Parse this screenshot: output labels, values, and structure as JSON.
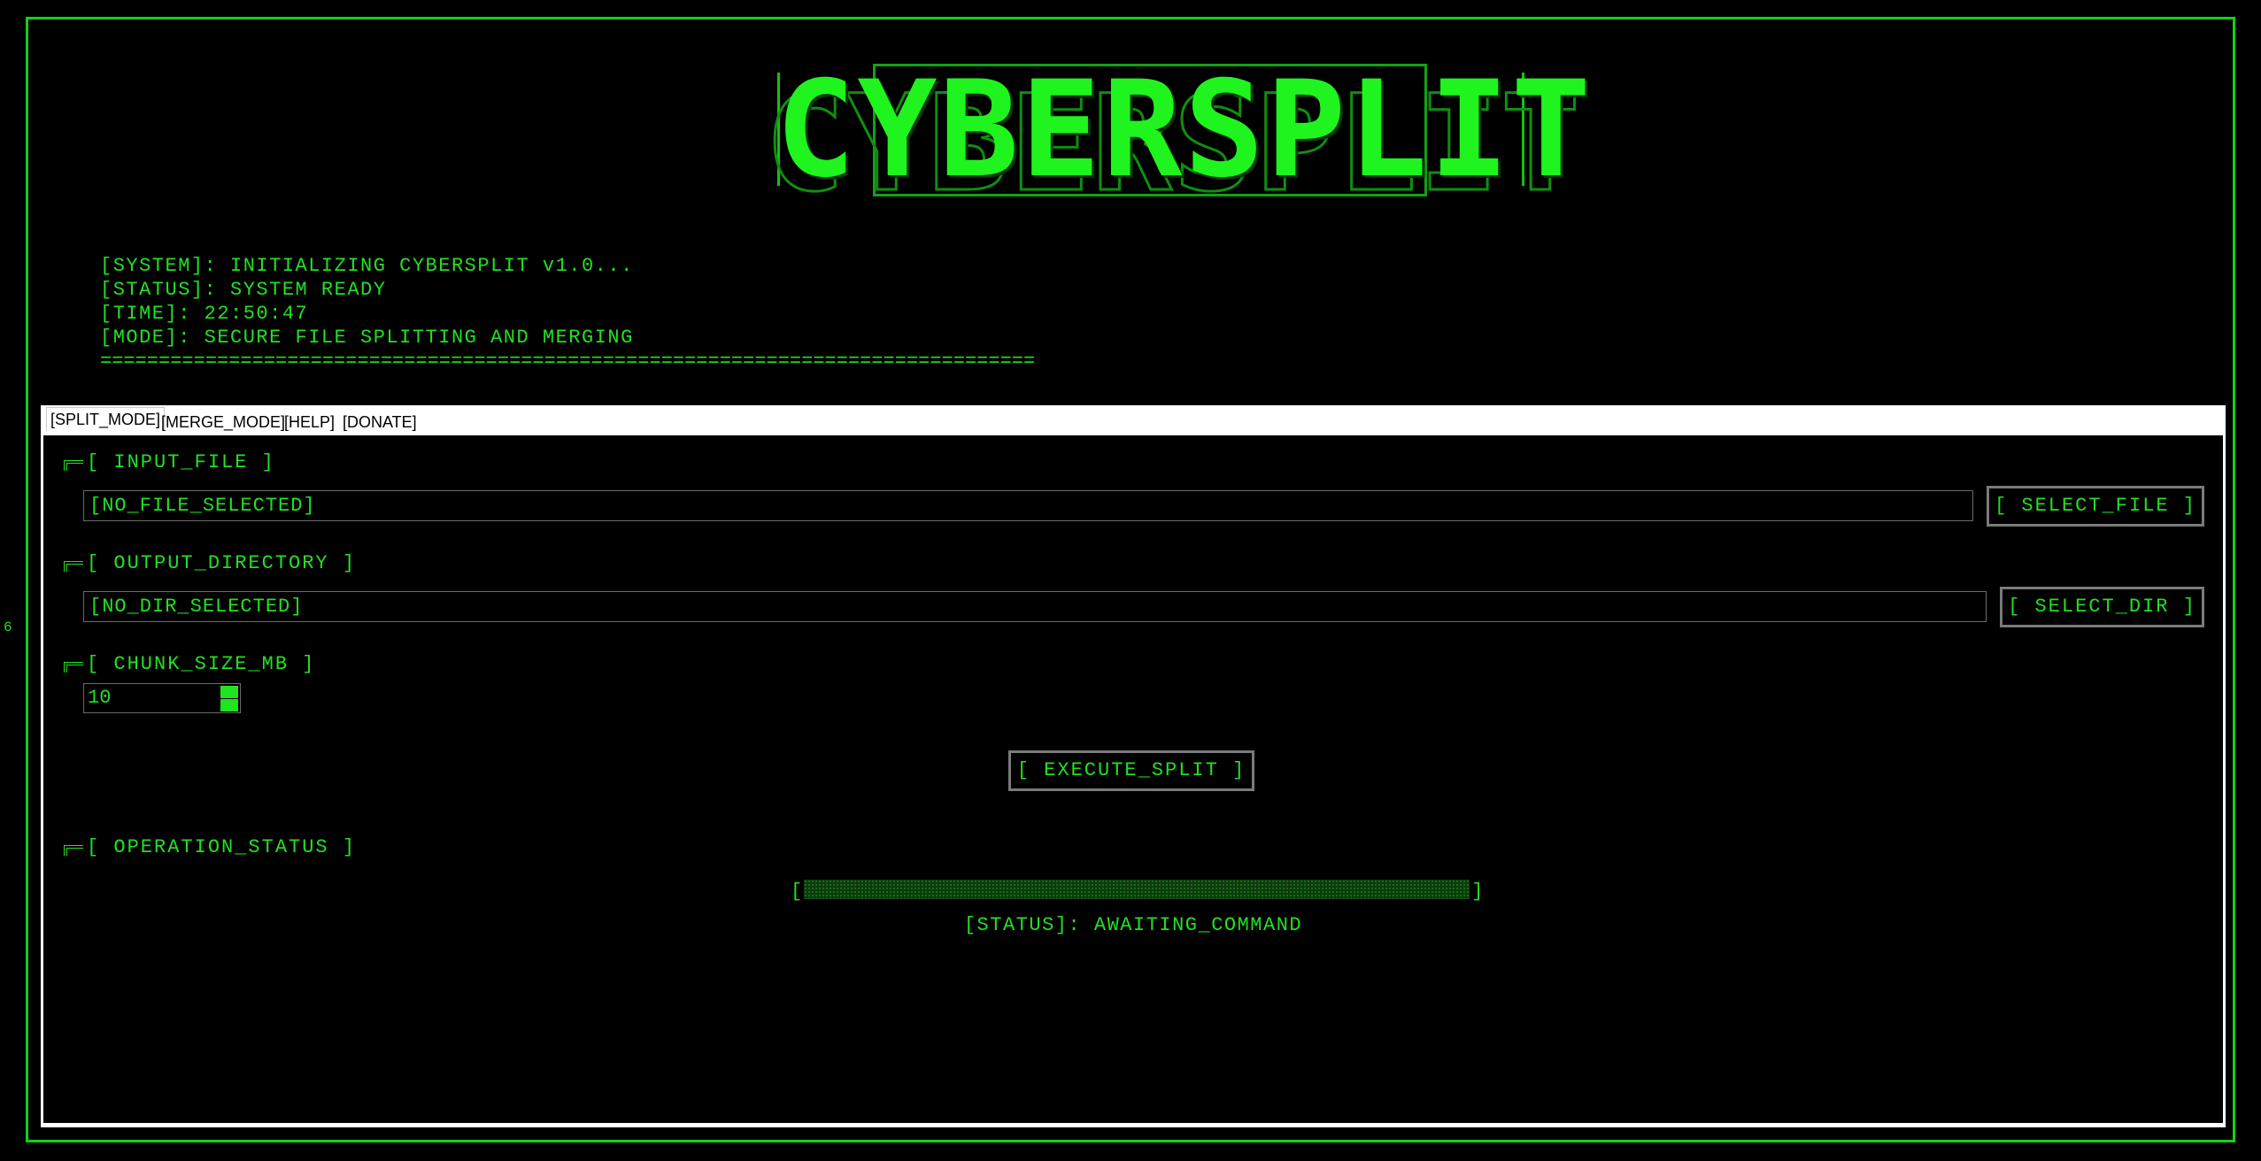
{
  "app": {
    "title": "CYBERSPLIT",
    "side_marker": "6"
  },
  "log": {
    "lines": [
      "[SYSTEM]: INITIALIZING CYBERSPLIT v1.0...",
      "[STATUS]: SYSTEM READY",
      "[TIME]: 22:50:47",
      "[MODE]: SECURE FILE SPLITTING AND MERGING"
    ],
    "rule": "================================================================================"
  },
  "tabs": [
    {
      "label": "[SPLIT_MODE]",
      "active": true
    },
    {
      "label": "[MERGE_MODE]",
      "active": false
    },
    {
      "label": "[HELP]",
      "active": false
    },
    {
      "label": "[DONATE]",
      "active": false
    }
  ],
  "split": {
    "input_file_label": "[ INPUT_FILE ]",
    "input_file_value": "[NO_FILE_SELECTED]",
    "select_file_button": "[ SELECT_FILE ]",
    "output_dir_label": "[ OUTPUT_DIRECTORY ]",
    "output_dir_value": "[NO_DIR_SELECTED]",
    "select_dir_button": "[ SELECT_DIR ]",
    "chunk_size_label": "[ CHUNK_SIZE_MB ]",
    "chunk_size_value": "10",
    "execute_button": "[ EXECUTE_SPLIT ]",
    "operation_status_label": "[ OPERATION_STATUS ]",
    "progress_open": "[",
    "progress_close": "]",
    "progress_fraction": 0,
    "status_text": "[STATUS]: AWAITING_COMMAND"
  },
  "colors": {
    "terminal_green": "#22e022",
    "background": "#000000",
    "frame_border": "#15d015",
    "tabbar_background": "#ffffff"
  },
  "icons": {
    "section_corner": "corner-bracket-icon",
    "spin_up": "increment-arrow-icon",
    "spin_down": "decrement-arrow-icon"
  }
}
